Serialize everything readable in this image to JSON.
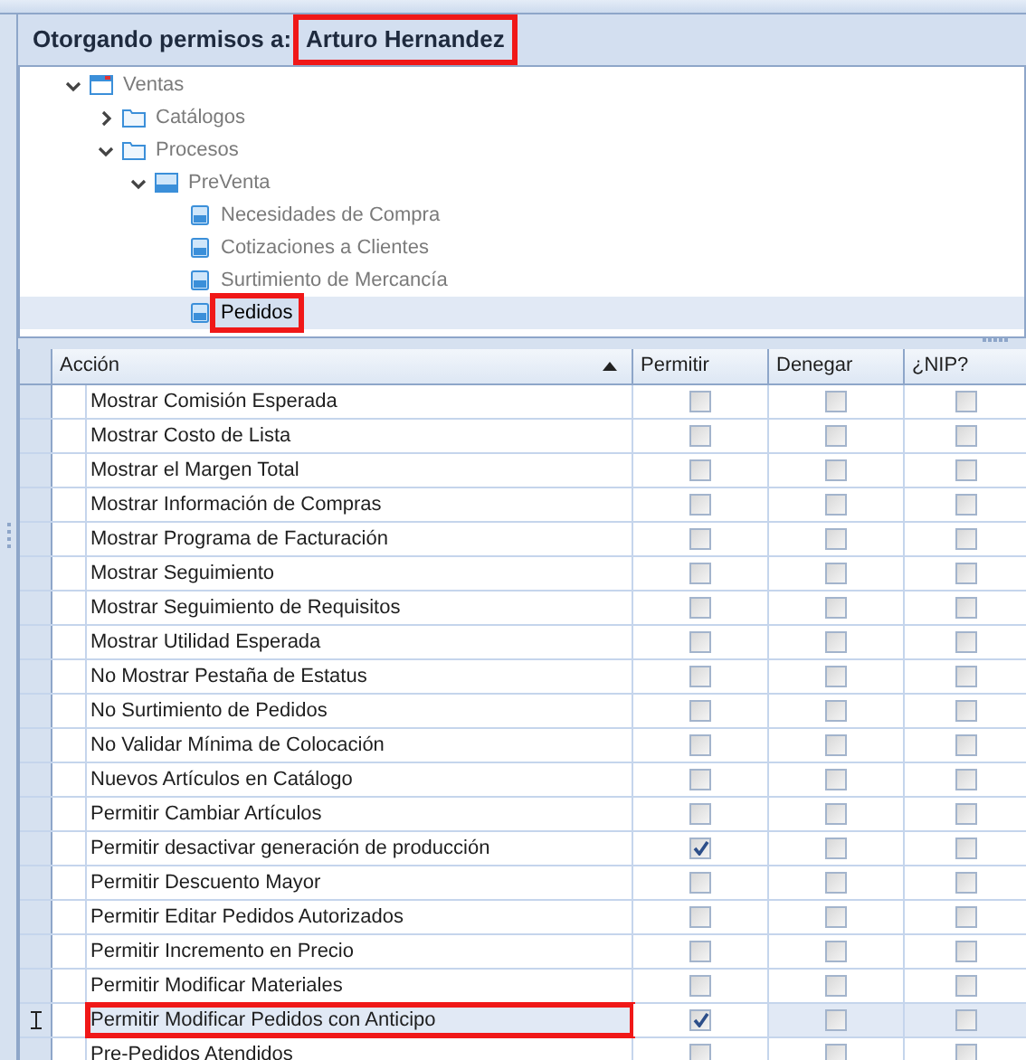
{
  "header": {
    "label": "Otorgando permisos a:",
    "user": "Arturo Hernandez",
    "highlighted": true
  },
  "tree": [
    {
      "label": "Ventas",
      "kind": "module",
      "expanded": true,
      "selected": false,
      "highlighted": false,
      "children": [
        {
          "label": "Catálogos",
          "kind": "folder",
          "expanded": false,
          "selected": false,
          "highlighted": false
        },
        {
          "label": "Procesos",
          "kind": "folder",
          "expanded": true,
          "selected": false,
          "highlighted": false,
          "children": [
            {
              "label": "PreVenta",
              "kind": "form",
              "expanded": true,
              "selected": false,
              "highlighted": false,
              "children": [
                {
                  "label": "Necesidades de Compra",
                  "kind": "leaf",
                  "selected": false,
                  "highlighted": false
                },
                {
                  "label": "Cotizaciones a Clientes",
                  "kind": "leaf",
                  "selected": false,
                  "highlighted": false
                },
                {
                  "label": "Surtimiento de Mercancía",
                  "kind": "leaf",
                  "selected": false,
                  "highlighted": false
                },
                {
                  "label": "Pedidos",
                  "kind": "leaf",
                  "selected": true,
                  "highlighted": true
                }
              ]
            }
          ]
        }
      ]
    }
  ],
  "grid": {
    "columns": [
      {
        "label": "Acción",
        "sorted": true
      },
      {
        "label": "Permitir",
        "sorted": false
      },
      {
        "label": "Denegar",
        "sorted": false
      },
      {
        "label": "¿NIP?",
        "sorted": false
      }
    ],
    "rows": [
      {
        "action": "Mostrar Comisión Esperada",
        "permitir": false,
        "denegar": false,
        "nip": false,
        "selected": false,
        "highlighted": false
      },
      {
        "action": "Mostrar Costo de Lista",
        "permitir": false,
        "denegar": false,
        "nip": false,
        "selected": false,
        "highlighted": false
      },
      {
        "action": "Mostrar el Margen Total",
        "permitir": false,
        "denegar": false,
        "nip": false,
        "selected": false,
        "highlighted": false
      },
      {
        "action": "Mostrar Información de Compras",
        "permitir": false,
        "denegar": false,
        "nip": false,
        "selected": false,
        "highlighted": false
      },
      {
        "action": "Mostrar Programa de Facturación",
        "permitir": false,
        "denegar": false,
        "nip": false,
        "selected": false,
        "highlighted": false
      },
      {
        "action": "Mostrar Seguimiento",
        "permitir": false,
        "denegar": false,
        "nip": false,
        "selected": false,
        "highlighted": false
      },
      {
        "action": "Mostrar Seguimiento de Requisitos",
        "permitir": false,
        "denegar": false,
        "nip": false,
        "selected": false,
        "highlighted": false
      },
      {
        "action": "Mostrar Utilidad Esperada",
        "permitir": false,
        "denegar": false,
        "nip": false,
        "selected": false,
        "highlighted": false
      },
      {
        "action": "No Mostrar Pestaña de Estatus",
        "permitir": false,
        "denegar": false,
        "nip": false,
        "selected": false,
        "highlighted": false
      },
      {
        "action": "No Surtimiento de Pedidos",
        "permitir": false,
        "denegar": false,
        "nip": false,
        "selected": false,
        "highlighted": false
      },
      {
        "action": "No Validar Mínima de Colocación",
        "permitir": false,
        "denegar": false,
        "nip": false,
        "selected": false,
        "highlighted": false
      },
      {
        "action": "Nuevos Artículos en Catálogo",
        "permitir": false,
        "denegar": false,
        "nip": false,
        "selected": false,
        "highlighted": false
      },
      {
        "action": "Permitir Cambiar Artículos",
        "permitir": false,
        "denegar": false,
        "nip": false,
        "selected": false,
        "highlighted": false
      },
      {
        "action": "Permitir desactivar generación de producción",
        "permitir": true,
        "denegar": false,
        "nip": false,
        "selected": false,
        "highlighted": false
      },
      {
        "action": "Permitir Descuento Mayor",
        "permitir": false,
        "denegar": false,
        "nip": false,
        "selected": false,
        "highlighted": false
      },
      {
        "action": "Permitir Editar Pedidos Autorizados",
        "permitir": false,
        "denegar": false,
        "nip": false,
        "selected": false,
        "highlighted": false
      },
      {
        "action": "Permitir Incremento en Precio",
        "permitir": false,
        "denegar": false,
        "nip": false,
        "selected": false,
        "highlighted": false
      },
      {
        "action": "Permitir Modificar Materiales",
        "permitir": false,
        "denegar": false,
        "nip": false,
        "selected": false,
        "highlighted": false
      },
      {
        "action": "Permitir Modificar Pedidos con Anticipo",
        "permitir": true,
        "denegar": false,
        "nip": false,
        "selected": true,
        "highlighted": true
      },
      {
        "action": "Pre-Pedidos Atendidos",
        "permitir": false,
        "denegar": false,
        "nip": false,
        "selected": false,
        "highlighted": false
      }
    ]
  }
}
